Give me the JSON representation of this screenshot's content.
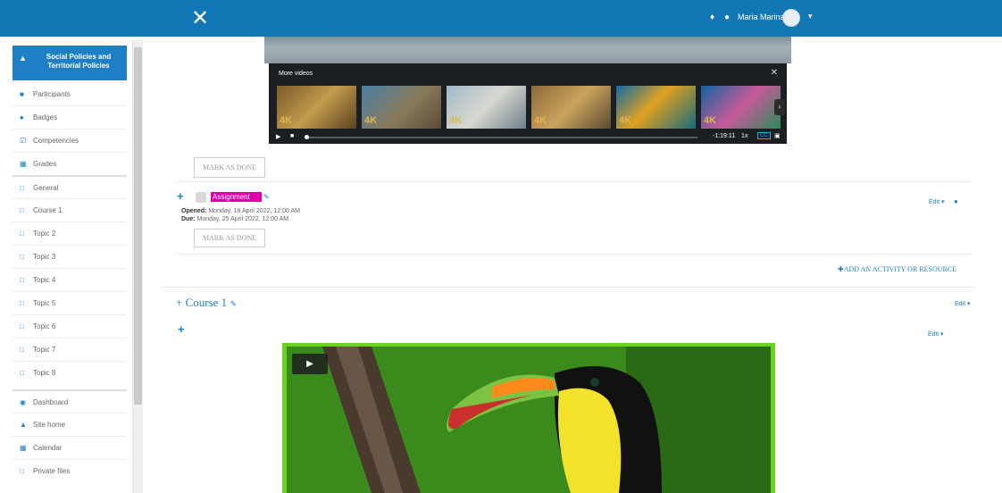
{
  "topbar": {
    "close_glyph": "✕",
    "bell_icon": "bell-icon",
    "chat_icon": "chat-icon",
    "user_name": "Maria Marina",
    "caret": "▾",
    "bar_color": "#1177b5"
  },
  "sidebar": {
    "course_title": "Social Policies and Territorial Policies",
    "items": [
      {
        "label": "Participants",
        "icon": "users-icon"
      },
      {
        "label": "Badges",
        "icon": "badge-icon"
      },
      {
        "label": "Competencies",
        "icon": "checkbox-icon"
      },
      {
        "label": "Grades",
        "icon": "table-icon"
      },
      {
        "label": "General",
        "icon": "folder-icon"
      },
      {
        "label": "Course 1",
        "icon": "folder-icon"
      },
      {
        "label": "Topic 2",
        "icon": "folder-icon"
      },
      {
        "label": "Topic 3",
        "icon": "folder-icon"
      },
      {
        "label": "Topic 4",
        "icon": "folder-icon"
      },
      {
        "label": "Topic 5",
        "icon": "folder-icon"
      },
      {
        "label": "Topic 6",
        "icon": "folder-icon"
      },
      {
        "label": "Topic 7",
        "icon": "folder-icon"
      },
      {
        "label": "Topic 8",
        "icon": "folder-icon"
      },
      {
        "label": "Dashboard",
        "icon": "dashboard-icon"
      },
      {
        "label": "Site home",
        "icon": "home-icon"
      },
      {
        "label": "Calendar",
        "icon": "calendar-icon"
      },
      {
        "label": "Private files",
        "icon": "file-icon"
      }
    ]
  },
  "video_panel": {
    "title": "More videos",
    "close": "✕",
    "time": "-1:19:11",
    "speed": "1x",
    "cc": "CC",
    "thumb_badge": "4K"
  },
  "activities": {
    "mark_done_1": "MARK AS DONE",
    "assignment_name": "Assignment",
    "opened_label": "Opened:",
    "opened_value": "Monday, 18 April 2022, 12:00 AM",
    "due_label": "Due:",
    "due_value": "Monday, 25 April 2022, 12:00 AM",
    "mark_done_2": "MARK AS DONE",
    "edit_1": "Edit ▾",
    "add_activity": "ADD AN ACTIVITY OR RESOURCE"
  },
  "section": {
    "title": "Course 1",
    "edit": "Edit ▾",
    "edit_2": "Edit ▾"
  },
  "colors": {
    "accent": "#1f7fc4",
    "highlight": "#e000a8",
    "video_border": "#6bd423"
  }
}
